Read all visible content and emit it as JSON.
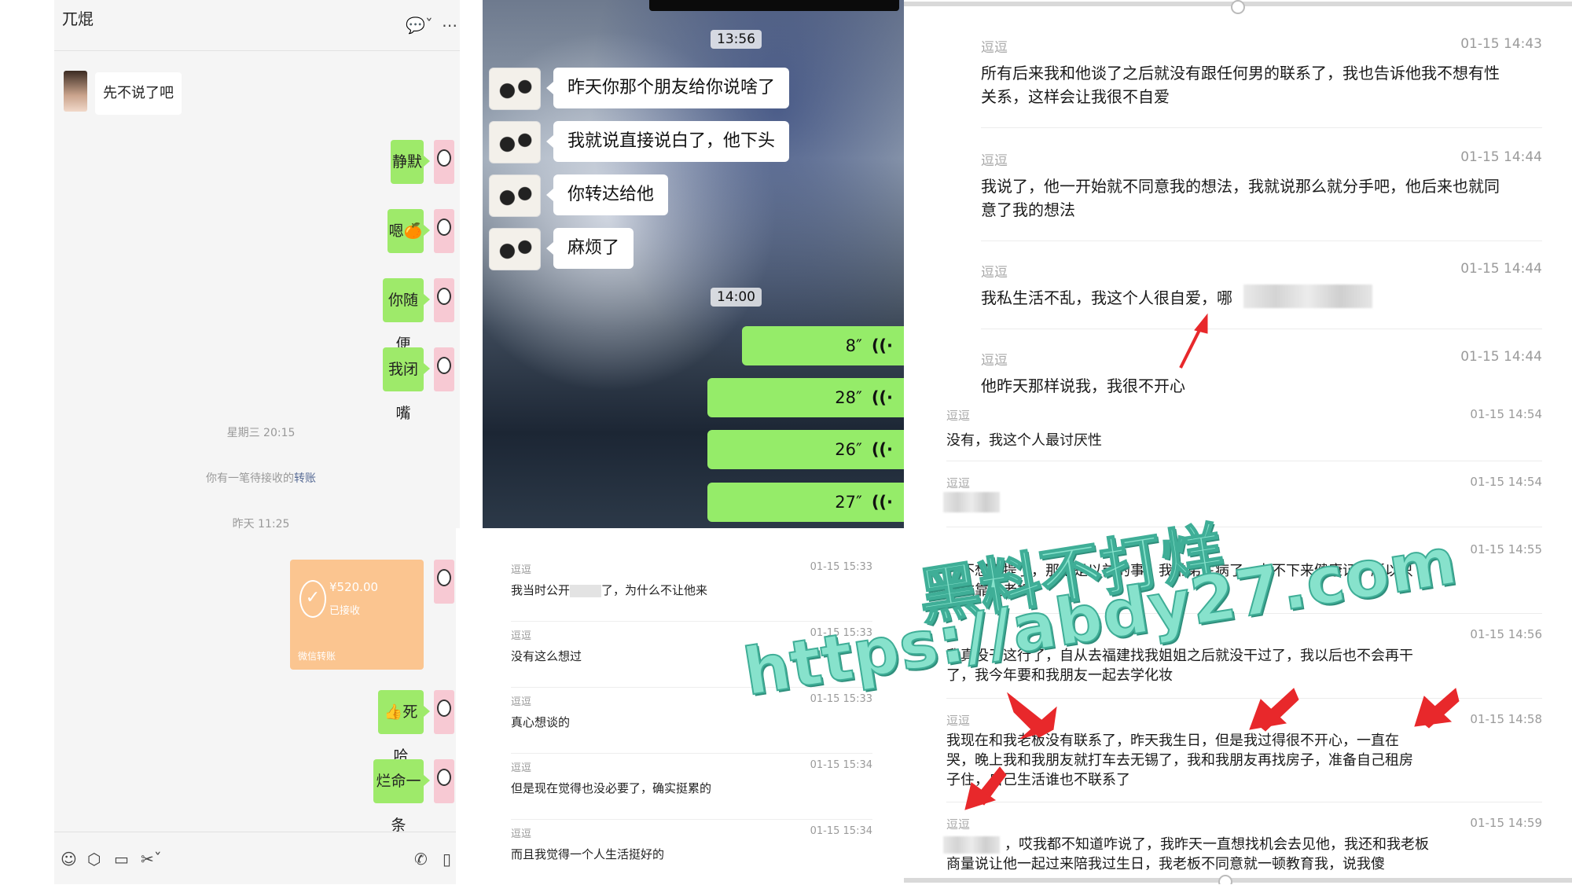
{
  "left_chat": {
    "title": "兀焜",
    "incoming": {
      "text": "先不说了吧"
    },
    "outgoing": [
      {
        "text": "静默"
      },
      {
        "text": "嗯🍊"
      },
      {
        "text": "你随便"
      },
      {
        "text": "我闭嘴"
      },
      {
        "text": "👍死哈"
      },
      {
        "text": "烂命一条"
      }
    ],
    "system": {
      "time1": "星期三 20:15",
      "transfer_notice_prefix": "你有一笔待接收的",
      "transfer_notice_link": "转账",
      "time2": "昨天 11:25"
    },
    "transfer": {
      "amount": "¥520.00",
      "status": "已接收",
      "footer": "微信转账",
      "icon": "check-circle-icon"
    }
  },
  "phone_chat": {
    "time1": "13:56",
    "incoming": [
      "昨天你那个朋友给你说啥了",
      "我就说直接说白了，他下头",
      "你转达给他",
      "麻烦了"
    ],
    "time2": "14:00",
    "voice": [
      "8″",
      "28″",
      "26″",
      "27″"
    ]
  },
  "record_list": [
    {
      "name": "逗逗",
      "time": "01-15 15:33",
      "text_a": "我当时公开",
      "text_b": "了，为什么不让他来"
    },
    {
      "name": "逗逗",
      "time": "01-15 15:33",
      "text": "没有这么想过"
    },
    {
      "name": "逗逗",
      "time": "01-15 15:33",
      "text": "真心想谈的"
    },
    {
      "name": "逗逗",
      "time": "01-15 15:34",
      "text": "但是现在觉得也没必要了，确实挺累的"
    },
    {
      "name": "逗逗",
      "time": "01-15 15:34",
      "text": "而且我觉得一个人生活挺好的"
    }
  ],
  "right_chat": [
    {
      "name": "逗逗",
      "time": "01-15 14:43",
      "line1": "所有后来我和他谈了之后就没有跟任何男的联系了，我也告诉他我不想有性",
      "line2": "关系，这样会让我很不自爱"
    },
    {
      "name": "逗逗",
      "time": "01-15 14:44",
      "line1": "我说了，他一开始就不同意我的想法，我就说那么就分手吧，他后来也就同",
      "line2": "意了我的想法"
    },
    {
      "name": "逗逗",
      "time": "01-15 14:44",
      "line1": "我私生活不乱，我这个人很自爱，哪"
    },
    {
      "name": "逗逗",
      "time": "01-15 14:44",
      "line1": "他昨天那样说我，我很不开心"
    },
    {
      "name": "逗逗",
      "time": "01-15 14:54",
      "line1": "没有，我这个人最讨厌性"
    },
    {
      "name": "逗逗",
      "time": "01-15 14:54",
      "line1": ""
    },
    {
      "name": "",
      "time": "01-15 14:55",
      "line1": "我不想再提了，那都是以前的事，我弟弟生病了，办不下来健康证，所以只",
      "line2": "能依靠我老板"
    },
    {
      "name": "",
      "time": "01-15 14:56",
      "line1": "我真没干这行了，自从去福建找我姐姐之后就没干过了，我以后也不会再干",
      "line2": "了，我今年要和我朋友一起去学化妆"
    },
    {
      "name": "逗逗",
      "time": "01-15 14:58",
      "line1": "我现在和我老板没有联系了，昨天我生日，但是我过得很不开心，一直在",
      "line2": "哭，晚上我和我朋友就打车去无锡了，我和我朋友再找房子，准备自己租房",
      "line3": "子住，自己生活谁也不联系了"
    },
    {
      "name": "逗逗",
      "time": "01-15 14:59",
      "line1": "，哎我都不知道咋说了，我昨天一直想找机会去见他，我还和我老板",
      "line2": "商量说让他一起过来陪我过生日，我老板不同意就一顿教育我，说我傻"
    }
  ],
  "watermark": {
    "line1": "黑料不打烊",
    "line2": "https://abdy27.com"
  },
  "colors": {
    "wechat_green": "#95ec69",
    "transfer_orange": "#fbc590",
    "watermark": "#87e2cc",
    "arrow_red": "#e8282b"
  }
}
